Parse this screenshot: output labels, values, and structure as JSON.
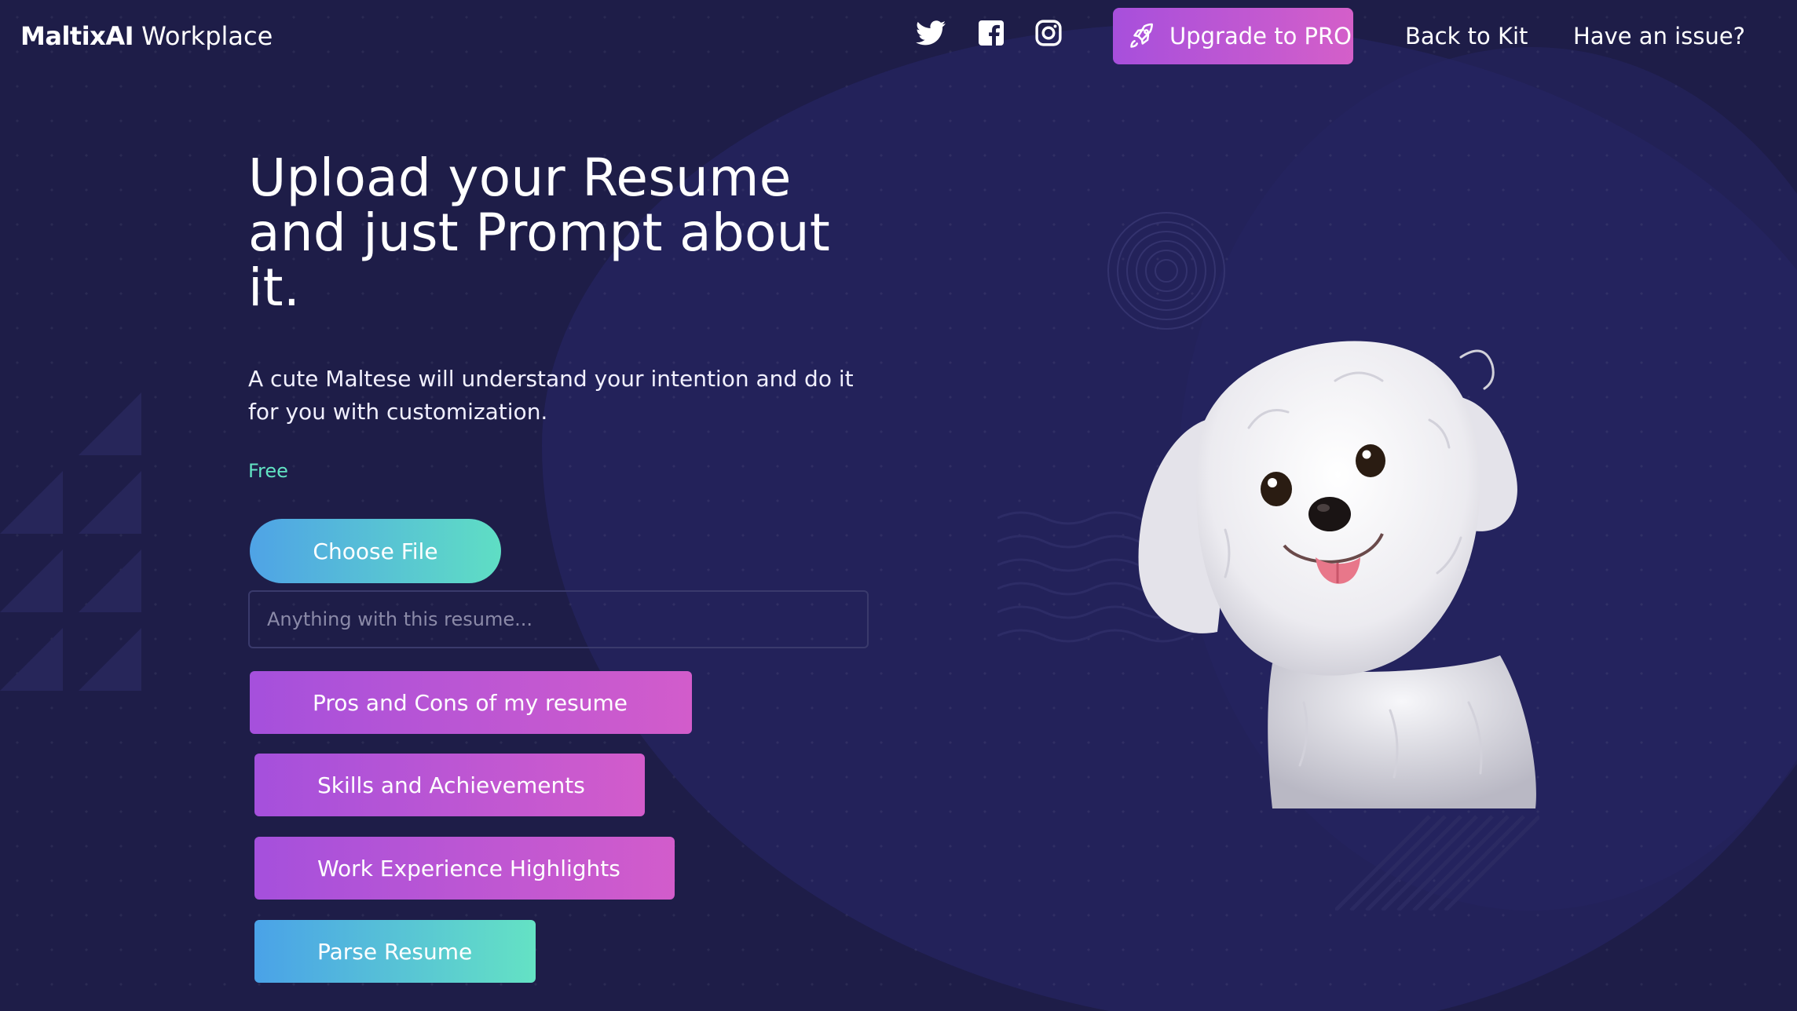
{
  "brand": {
    "bold": "MaltixAI",
    "light": "Workplace"
  },
  "nav": {
    "social": [
      {
        "icon": "twitter-icon"
      },
      {
        "icon": "facebook-icon"
      },
      {
        "icon": "instagram-icon"
      }
    ],
    "upgrade_label": "Upgrade to PRO",
    "upgrade_icon": "rocket-icon",
    "back_label": "Back to Kit",
    "issue_label": "Have an issue?"
  },
  "hero": {
    "title_line1": "Upload your Resume",
    "title_line2": "and just Prompt about",
    "title_line3": "it.",
    "subtitle_line1": "A cute Maltese will understand your intention and do it",
    "subtitle_line2": "for you with customization.",
    "badge": "Free"
  },
  "upload": {
    "choose_label": "Choose File",
    "prompt_placeholder": "Anything with this resume...",
    "prompt_value": ""
  },
  "actions": [
    {
      "label": "Pros and Cons of my resume"
    },
    {
      "label": "Skills and Achievements"
    },
    {
      "label": "Work Experience Highlights"
    },
    {
      "label": "Parse Resume"
    }
  ],
  "colors": {
    "background": "#1e1d48",
    "accent_purple": "#a74fdc",
    "accent_pink": "#d45fc9",
    "accent_blue": "#4fa3e6",
    "accent_teal": "#5fdec4",
    "free_text": "#62e3c3"
  }
}
